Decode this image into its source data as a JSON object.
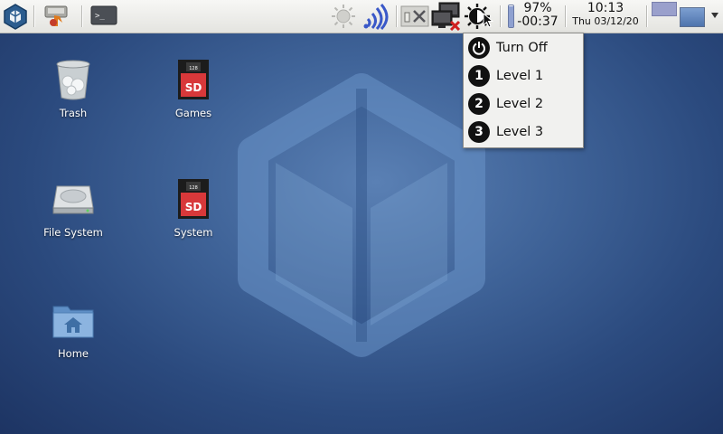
{
  "panel": {
    "battery": {
      "percent_label": "97%",
      "time_label": "-00:37",
      "level": 0.97
    },
    "clock": {
      "time": "10:13",
      "date": "Thu 03/12/20"
    },
    "icons": [
      "app-menu-logo-icon",
      "software-manager-icon",
      "terminal-icon",
      "brightness-icon",
      "wifi-icon",
      "cpu-frequency-icon",
      "network-disconnected-icon",
      "contrast-icon",
      "mouse-cursor",
      "workspace-1",
      "workspace-2",
      "show-desktop-dropdown"
    ]
  },
  "desktop": {
    "icons": [
      {
        "label": "Trash",
        "icon": "trash-icon"
      },
      {
        "label": "Games",
        "icon": "sd-card-icon"
      },
      {
        "label": "File System",
        "icon": "hard-drive-icon"
      },
      {
        "label": "System",
        "icon": "sd-card-icon"
      },
      {
        "label": "Home",
        "icon": "home-folder-icon"
      }
    ],
    "sd_card_text": {
      "capacity": "128",
      "brand": "SD"
    }
  },
  "menu": {
    "items": [
      {
        "label": "Turn Off",
        "icon": "power-icon"
      },
      {
        "label": "Level 1",
        "badge": "1"
      },
      {
        "label": "Level 2",
        "badge": "2"
      },
      {
        "label": "Level 3",
        "badge": "3"
      }
    ]
  },
  "colors": {
    "panel_bg": "#ececea",
    "desktop_bg": "#3f6398",
    "menu_bg": "#f1f1ef",
    "sd_red": "#d8383a"
  }
}
